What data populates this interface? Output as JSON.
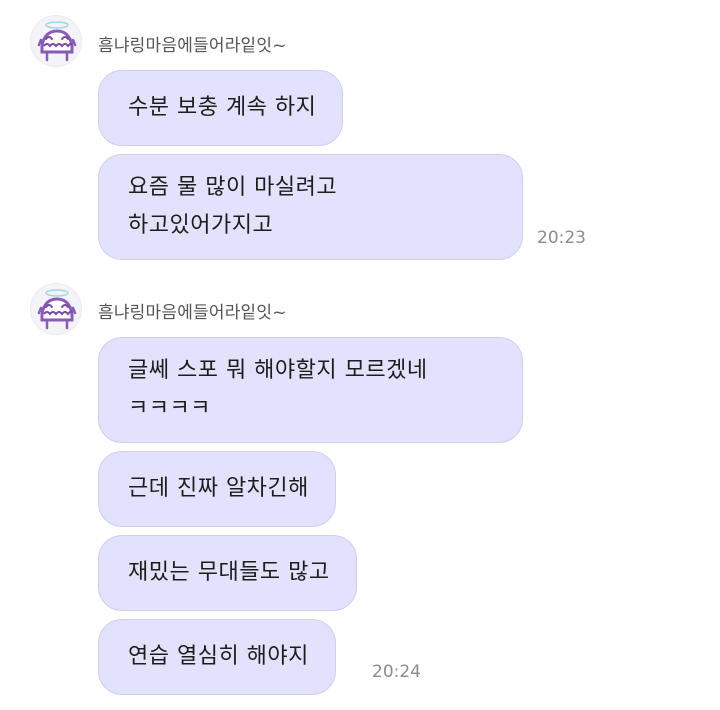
{
  "colors": {
    "bubble": "#e3e2fd",
    "bubble_border": "#cfcdf4",
    "accent": "#8a5bb4"
  },
  "groups": [
    {
      "sender": "흠냐링마음에들어라잍잇~",
      "avatar_icon": "ghost-angel-avatar-icon",
      "messages": [
        {
          "text": "수분 보충 계속 하지"
        },
        {
          "text": "요즘 물 많이 마실려고\n하고있어가지고",
          "time": "20:23"
        }
      ]
    },
    {
      "sender": "흠냐링마음에들어라잍잇~",
      "avatar_icon": "ghost-angel-avatar-icon",
      "messages": [
        {
          "text": "글쎄 스포 뭐 해야할지 모르겠네\nㅋㅋㅋㅋ"
        },
        {
          "text": "근데 진짜 알차긴해"
        },
        {
          "text": "재밌는 무대들도 많고"
        },
        {
          "text": "연습 열심히 해야지",
          "time": "20:24"
        }
      ]
    }
  ]
}
